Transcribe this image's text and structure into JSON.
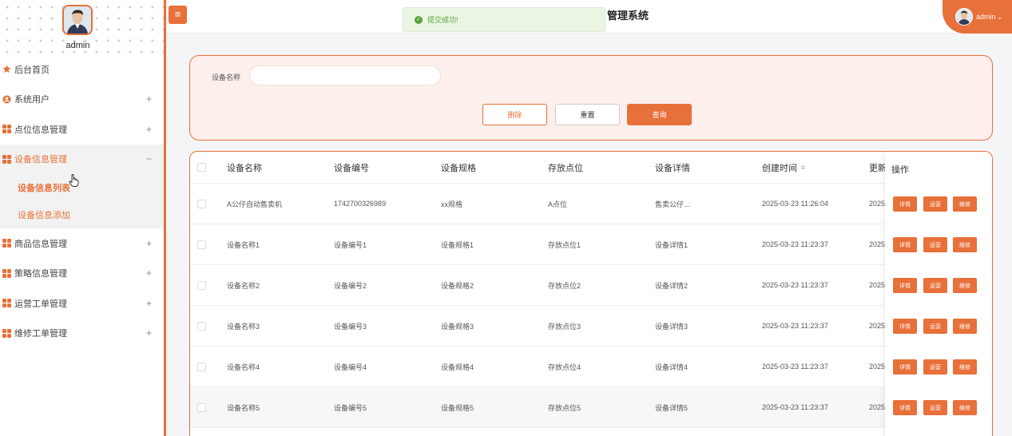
{
  "sidebar": {
    "user": "admin",
    "items": [
      {
        "label": "后台首页",
        "toggle": ""
      },
      {
        "label": "系统用户",
        "toggle": "+"
      },
      {
        "label": "点位信息管理",
        "toggle": "+"
      },
      {
        "label": "设备信息管理",
        "toggle": "−"
      },
      {
        "label": "商品信息管理",
        "toggle": "+"
      },
      {
        "label": "策略信息管理",
        "toggle": "+"
      },
      {
        "label": "运营工单管理",
        "toggle": "+"
      },
      {
        "label": "维修工单管理",
        "toggle": "+"
      }
    ],
    "sub_items": [
      "设备信息列表",
      "设备信息添加"
    ]
  },
  "header": {
    "toast": "提交成功!",
    "title": "管理系统",
    "user": "admin",
    "menu_toggle": "≡"
  },
  "search": {
    "label": "设备名称",
    "value": "",
    "buttons": {
      "delete": "删除",
      "reset": "重置",
      "query": "查询"
    }
  },
  "table": {
    "headers": [
      "设备名称",
      "设备编号",
      "设备规格",
      "存放点位",
      "设备详情",
      "创建时间",
      "更新",
      "操作"
    ],
    "sort_icon": "≑",
    "rows": [
      [
        "A公仔自动售卖机",
        "1742700326989",
        "xx规格",
        "A点位",
        "售卖公仔...",
        "2025-03-23 11:26:04",
        "2025"
      ],
      [
        "设备名称1",
        "设备编号1",
        "设备规格1",
        "存放点位1",
        "设备详情1",
        "2025-03-23 11:23:37",
        "2025"
      ],
      [
        "设备名称2",
        "设备编号2",
        "设备规格2",
        "存放点位2",
        "设备详情2",
        "2025-03-23 11:23:37",
        "2025"
      ],
      [
        "设备名称3",
        "设备编号3",
        "设备规格3",
        "存放点位3",
        "设备详情3",
        "2025-03-23 11:23:37",
        "2025"
      ],
      [
        "设备名称4",
        "设备编号4",
        "设备规格4",
        "存放点位4",
        "设备详情4",
        "2025-03-23 11:23:37",
        "2025"
      ],
      [
        "设备名称5",
        "设备编号5",
        "设备规格5",
        "存放点位5",
        "设备详情5",
        "2025-03-23 11:23:37",
        "2025"
      ]
    ],
    "actions": [
      "详情",
      "运营",
      "维修"
    ]
  },
  "colors": {
    "accent": "#e8703a",
    "success": "#58a33a"
  }
}
